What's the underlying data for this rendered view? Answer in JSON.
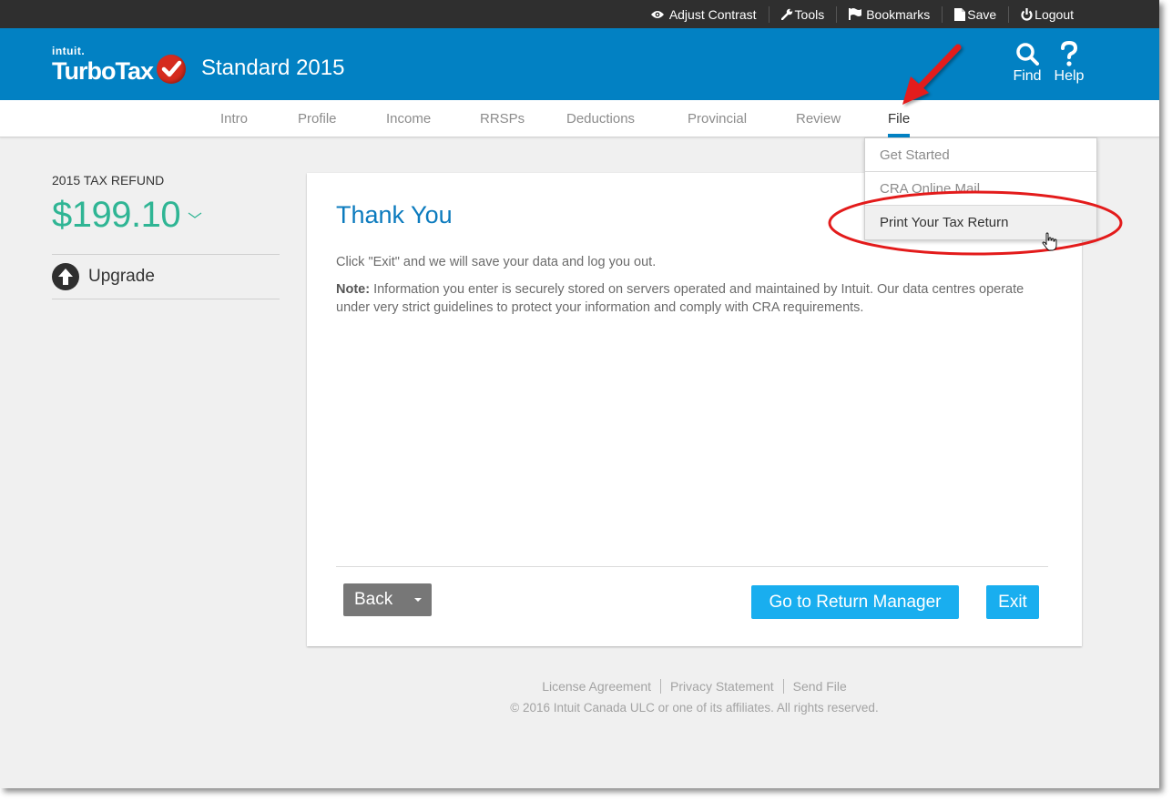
{
  "utility_bar": {
    "items": [
      {
        "label": "Adjust Contrast",
        "icon": "eye-icon"
      },
      {
        "label": "Tools",
        "icon": "wrench-icon"
      },
      {
        "label": "Bookmarks",
        "icon": "flag-icon"
      },
      {
        "label": "Save",
        "icon": "document-icon"
      },
      {
        "label": "Logout",
        "icon": "power-icon"
      }
    ]
  },
  "header": {
    "brand_small": "intuit.",
    "brand": "TurboTax",
    "product": "Standard 2015",
    "find_label": "Find",
    "help_label": "Help"
  },
  "nav": {
    "tabs": [
      {
        "label": "Intro"
      },
      {
        "label": "Profile"
      },
      {
        "label": "Income"
      },
      {
        "label": "RRSPs"
      },
      {
        "label": "Deductions"
      },
      {
        "label": "Provincial"
      },
      {
        "label": "Review"
      },
      {
        "label": "File",
        "active": true
      }
    ]
  },
  "file_menu": {
    "items": [
      {
        "label": "Get Started"
      },
      {
        "label": "CRA Online Mail"
      },
      {
        "label": "Print Your Tax Return",
        "hovered": true
      }
    ]
  },
  "sidebar": {
    "refund_label": "2015 TAX REFUND",
    "refund_amount": "$199.10",
    "upgrade_label": "Upgrade"
  },
  "card": {
    "title": "Thank You",
    "paragraph1": "Click \"Exit\" and we will save your data and log you out.",
    "note_label": "Note:",
    "note_text": " Information you enter is securely stored on servers operated and maintained by Intuit. Our data centres operate under very strict guidelines to protect your information and comply with CRA requirements.",
    "back_label": "Back",
    "return_manager_label": "Go to Return Manager",
    "exit_label": "Exit"
  },
  "footer": {
    "links": [
      "License Agreement",
      "Privacy Statement",
      "Send File"
    ],
    "copyright": "© 2016 Intuit Canada ULC or one of its affiliates. All rights reserved."
  },
  "colors": {
    "header_blue": "#0281c3",
    "utility_bar": "#2f2f2f",
    "refund_green": "#2fb594",
    "button_blue": "#19aeef",
    "button_grey": "#777777",
    "annotation_red": "#e31b1b"
  }
}
